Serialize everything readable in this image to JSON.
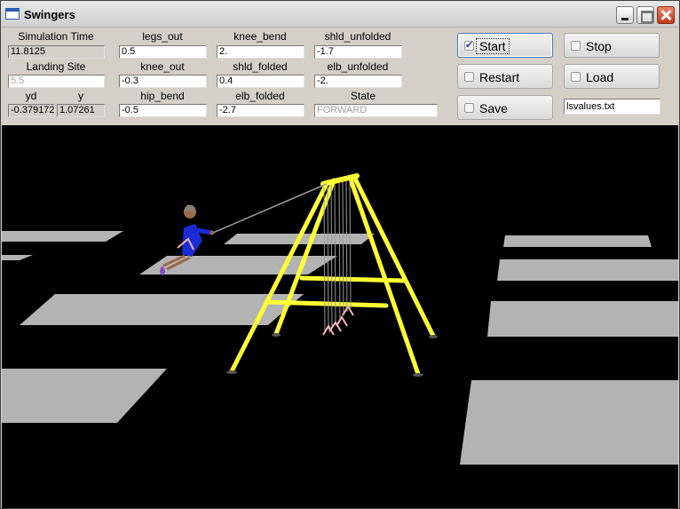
{
  "window": {
    "title": "Swingers"
  },
  "fields": {
    "simulation_time": {
      "label": "Simulation Time",
      "value": "11.8125"
    },
    "landing_site": {
      "label": "Landing Site",
      "value": "5.5"
    },
    "yd": {
      "label": "yd",
      "value": "-0.379172"
    },
    "y": {
      "label": "y",
      "value": "1.07261"
    },
    "legs_out": {
      "label": "legs_out",
      "value": "0.5"
    },
    "knee_out": {
      "label": "knee_out",
      "value": "-0.3"
    },
    "hip_bend": {
      "label": "hip_bend",
      "value": "-0.5"
    },
    "knee_bend": {
      "label": "knee_bend",
      "value": "2."
    },
    "shld_folded": {
      "label": "shld_folded",
      "value": "0.4"
    },
    "elb_folded": {
      "label": "elb_folded",
      "value": "-2.7"
    },
    "shld_unfolded": {
      "label": "shld_unfolded",
      "value": "-1.7"
    },
    "elb_unfolded": {
      "label": "elb_unfolded",
      "value": "-2."
    },
    "state": {
      "label": "State",
      "value": "FORWARD"
    }
  },
  "buttons": {
    "start": {
      "label": "Start",
      "checked": true
    },
    "stop": {
      "label": "Stop",
      "checked": false
    },
    "restart": {
      "label": "Restart",
      "checked": false
    },
    "load": {
      "label": "Load",
      "checked": false
    },
    "save": {
      "label": "Save",
      "checked": false
    }
  },
  "file_input": {
    "value": "lsvalues.txt"
  },
  "scene": {
    "background_color": "#000000",
    "ground_patch_color": "#b3b3b3",
    "frame_color": "#ffff33",
    "rope_color": "#9a9a9a",
    "figure_dress_color": "#1a2bd6"
  }
}
